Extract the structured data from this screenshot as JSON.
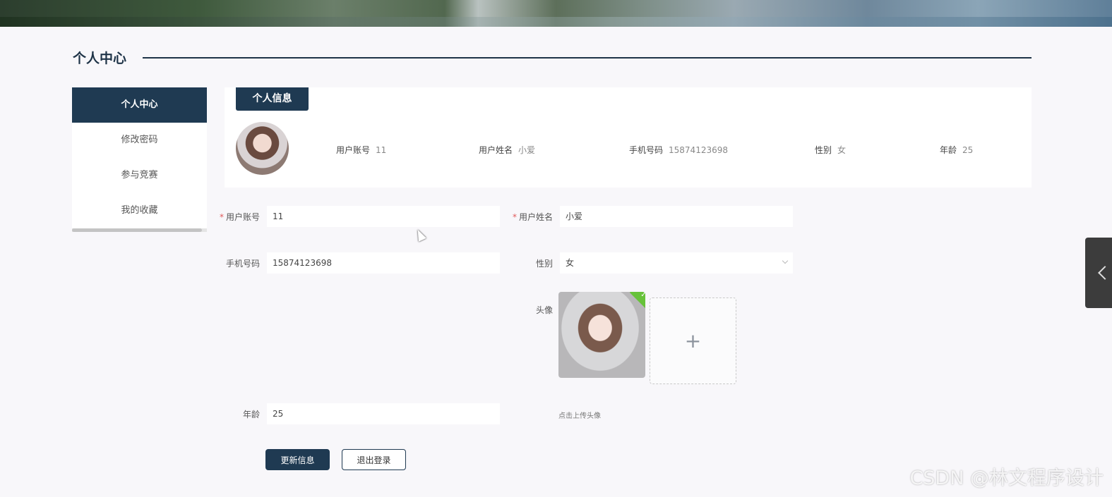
{
  "page": {
    "section_title": "个人中心"
  },
  "sidebar": {
    "items": [
      {
        "label": "个人中心",
        "active": true
      },
      {
        "label": "修改密码"
      },
      {
        "label": "参与竞赛"
      },
      {
        "label": "我的收藏"
      }
    ]
  },
  "info_card": {
    "tab_label": "个人信息",
    "fields": [
      {
        "label": "用户账号",
        "value": "11"
      },
      {
        "label": "用户姓名",
        "value": "小爱"
      },
      {
        "label": "手机号码",
        "value": "15874123698"
      },
      {
        "label": "性别",
        "value": "女"
      },
      {
        "label": "年龄",
        "value": "25"
      }
    ]
  },
  "form": {
    "account": {
      "label": "用户账号",
      "value": "11",
      "required": true
    },
    "name": {
      "label": "用户姓名",
      "value": "小爱",
      "required": true
    },
    "phone": {
      "label": "手机号码",
      "value": "15874123698"
    },
    "gender": {
      "label": "性别",
      "value": "女"
    },
    "avatar": {
      "label": "头像",
      "upload_tip": "点击上传头像"
    },
    "age": {
      "label": "年龄",
      "value": "25"
    }
  },
  "buttons": {
    "update": "更新信息",
    "logout": "退出登录"
  },
  "watermark": "CSDN @林文程序设计",
  "colors": {
    "primary": "#1f3a52",
    "required": "#e05a5a",
    "success": "#67c23a"
  }
}
